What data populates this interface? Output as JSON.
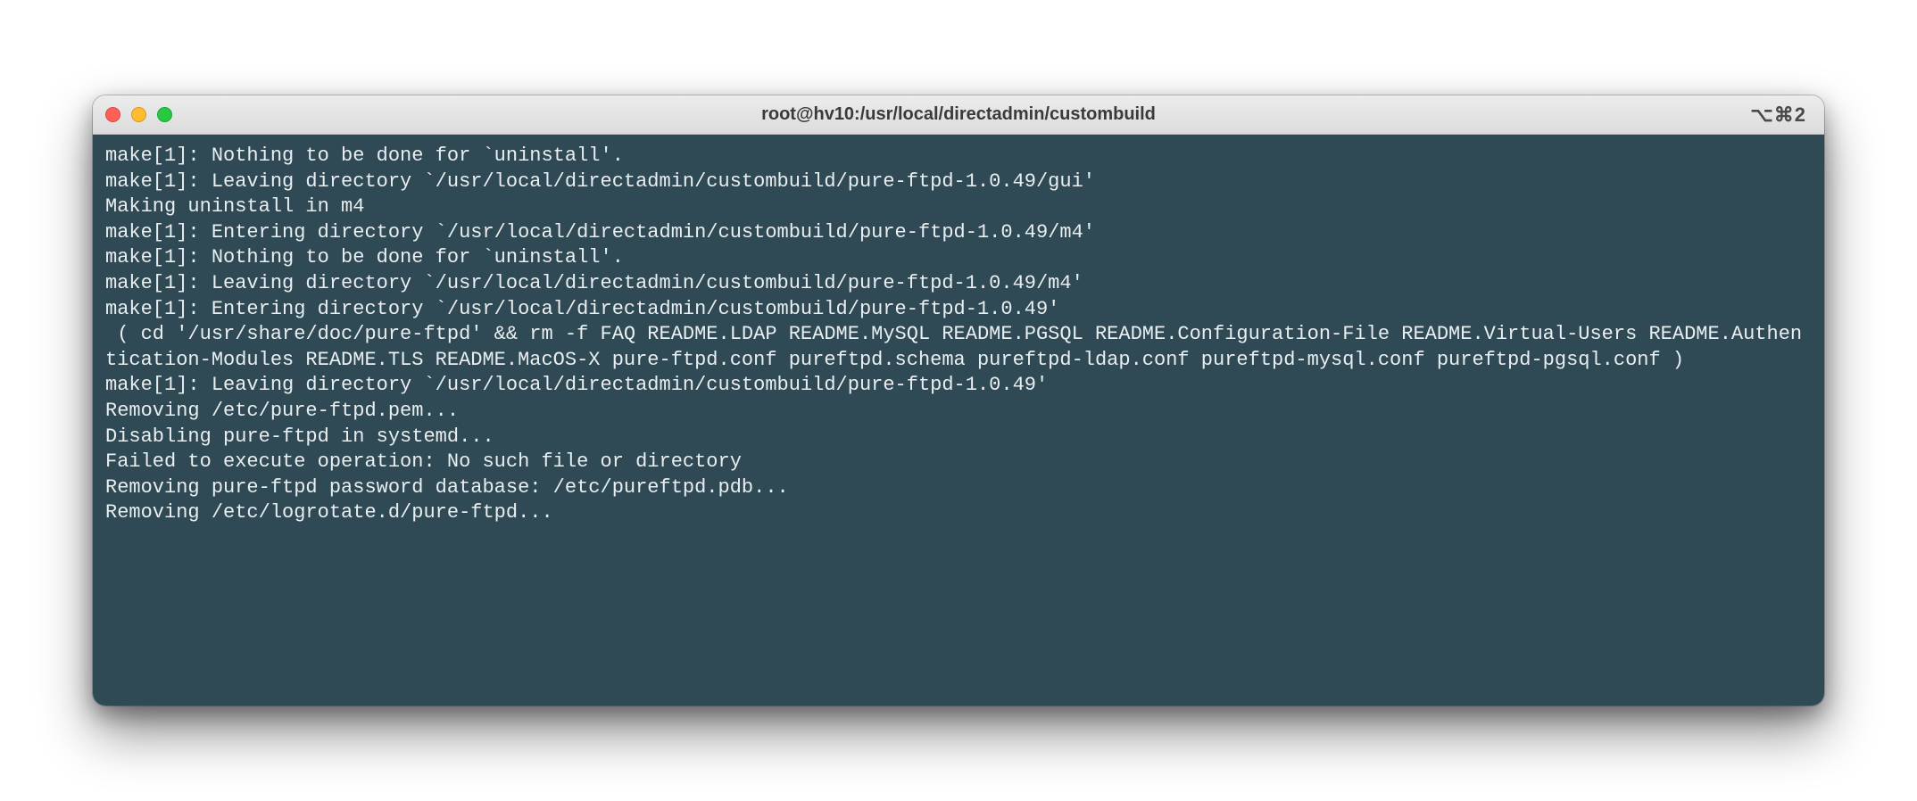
{
  "window": {
    "title": "root@hv10:/usr/local/directadmin/custombuild",
    "shortcut": "⌥⌘2"
  },
  "colors": {
    "terminal_bg": "#2f4a55",
    "terminal_fg": "#e9eef0",
    "close": "#ff5f57",
    "minimize": "#febc2e",
    "zoom": "#28c840"
  },
  "terminal": {
    "lines": [
      "make[1]: Nothing to be done for `uninstall'.",
      "make[1]: Leaving directory `/usr/local/directadmin/custombuild/pure-ftpd-1.0.49/gui'",
      "Making uninstall in m4",
      "make[1]: Entering directory `/usr/local/directadmin/custombuild/pure-ftpd-1.0.49/m4'",
      "make[1]: Nothing to be done for `uninstall'.",
      "make[1]: Leaving directory `/usr/local/directadmin/custombuild/pure-ftpd-1.0.49/m4'",
      "make[1]: Entering directory `/usr/local/directadmin/custombuild/pure-ftpd-1.0.49'",
      " ( cd '/usr/share/doc/pure-ftpd' && rm -f FAQ README.LDAP README.MySQL README.PGSQL README.Configuration-File README.Virtual-Users README.Authentication-Modules README.TLS README.MacOS-X pure-ftpd.conf pureftpd.schema pureftpd-ldap.conf pureftpd-mysql.conf pureftpd-pgsql.conf )",
      "make[1]: Leaving directory `/usr/local/directadmin/custombuild/pure-ftpd-1.0.49'",
      "Removing /etc/pure-ftpd.pem...",
      "Disabling pure-ftpd in systemd...",
      "Failed to execute operation: No such file or directory",
      "Removing pure-ftpd password database: /etc/pureftpd.pdb...",
      "Removing /etc/logrotate.d/pure-ftpd..."
    ]
  }
}
